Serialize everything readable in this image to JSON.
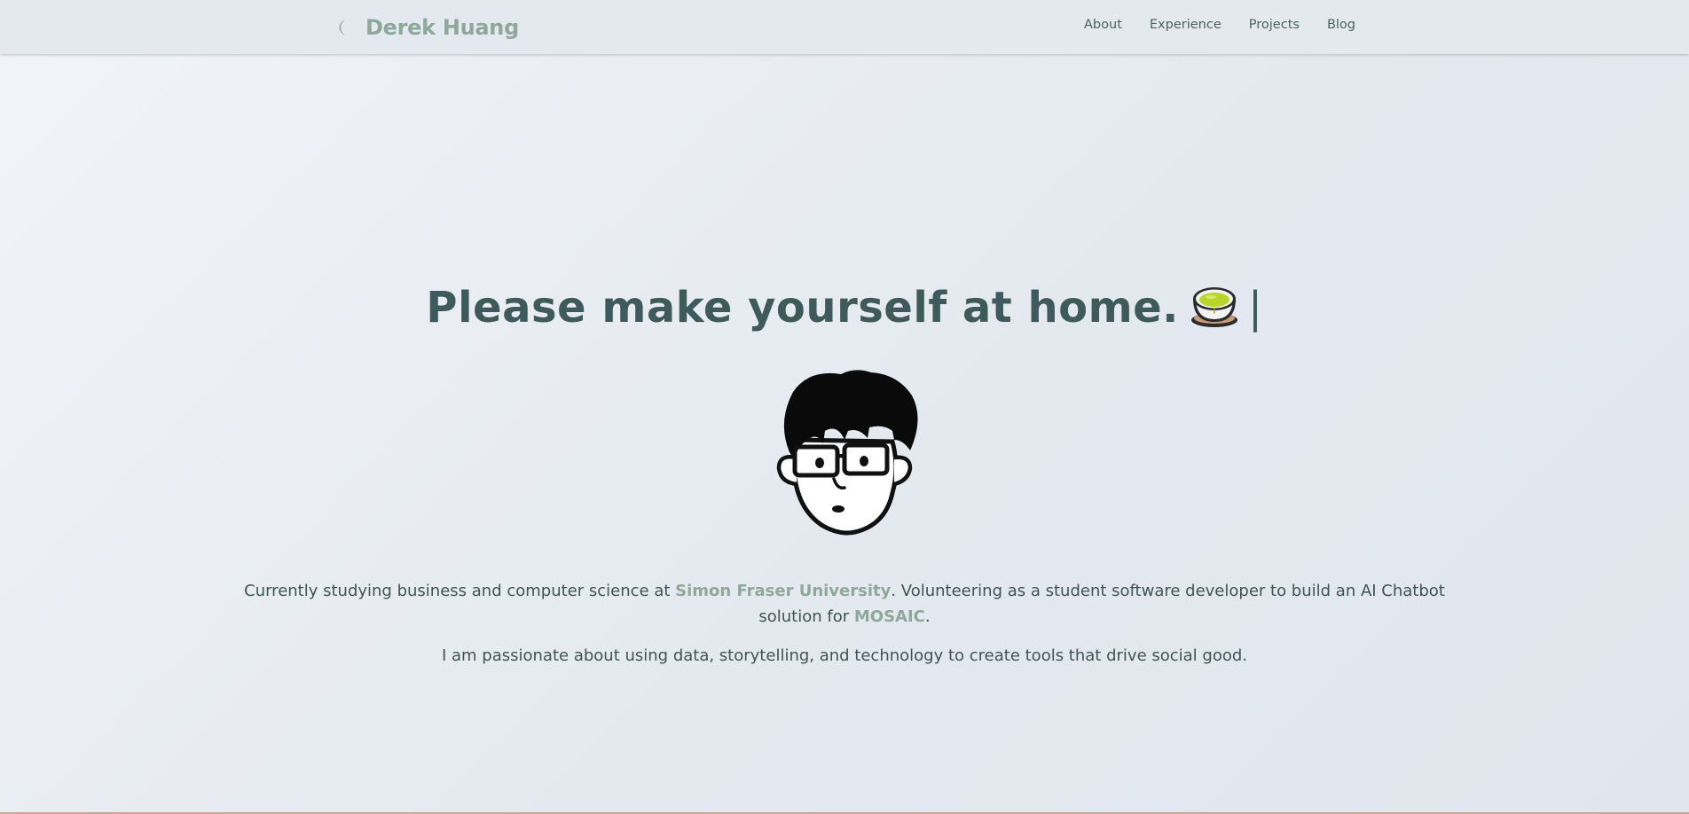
{
  "header": {
    "brand_name": "Derek Huang",
    "theme_toggle_icon": "moon-icon",
    "nav": [
      {
        "label": "About"
      },
      {
        "label": "Experience"
      },
      {
        "label": "Projects"
      },
      {
        "label": "Blog"
      }
    ]
  },
  "hero": {
    "title": "Please make yourself at home.",
    "emoji_icon": "green-tea-icon",
    "cursor": "|"
  },
  "avatar": {
    "icon": "cartoon-avatar-with-glasses"
  },
  "bio": {
    "line1_prefix": "Currently studying business and computer science at ",
    "university_link": "Simon Fraser University",
    "line1_middle": ". Volunteering as a student software developer to build an AI Chatbot solution for ",
    "org_link": "MOSAIC",
    "line1_suffix": ".",
    "line2": "I am passionate about using data, storytelling, and technology to create tools that drive social good."
  },
  "colors": {
    "accent": "#8ea999",
    "heading": "#3e5a5c",
    "background": "#e4e9f0"
  }
}
